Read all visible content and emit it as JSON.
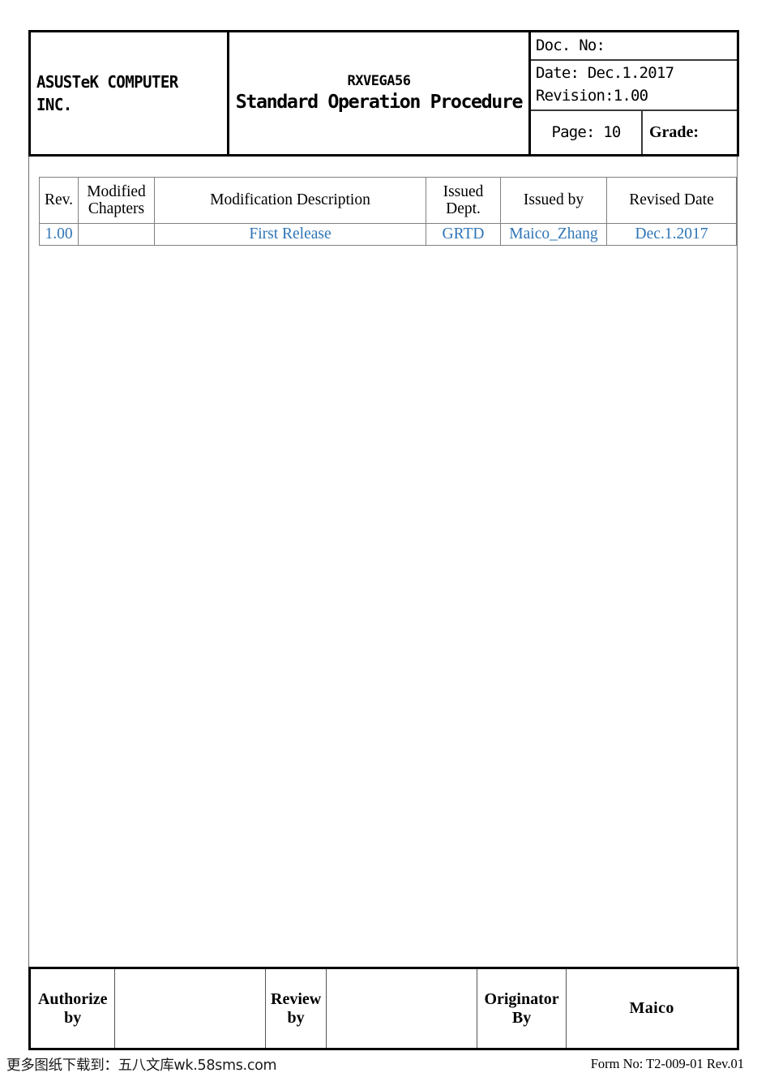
{
  "header": {
    "company": "ASUSTeK COMPUTER\nINC.",
    "title_sub": "RXVEGA56",
    "title_main": "Standard Operation Procedure",
    "doc_no_label": "Doc. No:",
    "date_line": "Date: Dec.1.2017",
    "revision_line": "Revision:1.00",
    "page_label": "Page: 10",
    "grade_label": "Grade:"
  },
  "revision_table": {
    "columns": [
      "Rev.",
      "Modified Chapters",
      "Modification Description",
      "Issued Dept.",
      "Issued by",
      "Revised Date"
    ],
    "rows": [
      {
        "rev": "1.00",
        "modified_chapters": "",
        "description": "First Release",
        "issued_dept": "GRTD",
        "issued_by": "Maico_Zhang",
        "revised_date": "Dec.1.2017"
      }
    ],
    "value_color": "#2E75B6"
  },
  "footer": {
    "authorize_label": "Authorize by",
    "authorize_value": "",
    "review_label": "Review by",
    "review_value": "",
    "originator_label": "Originator By",
    "originator_value": "Maico"
  },
  "bottom": {
    "watermark": "更多图纸下载到：五八文库wk.58sms.com",
    "form_no": "Form No: T2-009-01 Rev.01"
  }
}
